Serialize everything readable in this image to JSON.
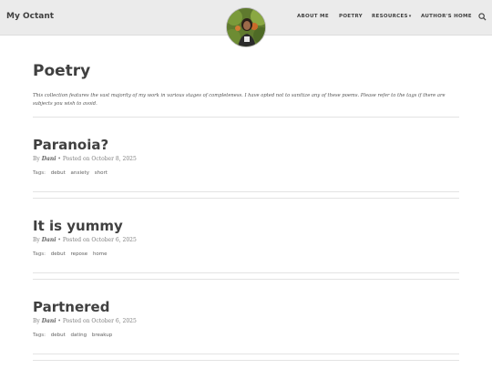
{
  "header": {
    "brand": "My Octant",
    "nav": [
      {
        "label": "ABOUT ME"
      },
      {
        "label": "POETRY"
      },
      {
        "label": "RESOURCES"
      },
      {
        "label": "AUTHOR'S HOME"
      }
    ],
    "search_icon": "search-icon",
    "avatar_icon": "profile-photo"
  },
  "page": {
    "title": "Poetry",
    "description": "This collection features the vast majority of my work in various stages of completeness. I have opted not to sanitize any of these poems. Please refer to the tags if there are subjects you wish to avoid."
  },
  "posts": [
    {
      "title": "Paranoia?",
      "by": "By",
      "author": "Dani",
      "posted": "• Posted on October 8, 2025",
      "tags_label": "Tags:",
      "tags": [
        "debut",
        "anxiety",
        "short"
      ]
    },
    {
      "title": "It is yummy",
      "by": "By",
      "author": "Dani",
      "posted": "• Posted on October 6, 2025",
      "tags_label": "Tags:",
      "tags": [
        "debut",
        "repose",
        "home"
      ]
    },
    {
      "title": "Partnered",
      "by": "By",
      "author": "Dani",
      "posted": "• Posted on October 6, 2025",
      "tags_label": "Tags:",
      "tags": [
        "debut",
        "dating",
        "breakup"
      ]
    }
  ]
}
